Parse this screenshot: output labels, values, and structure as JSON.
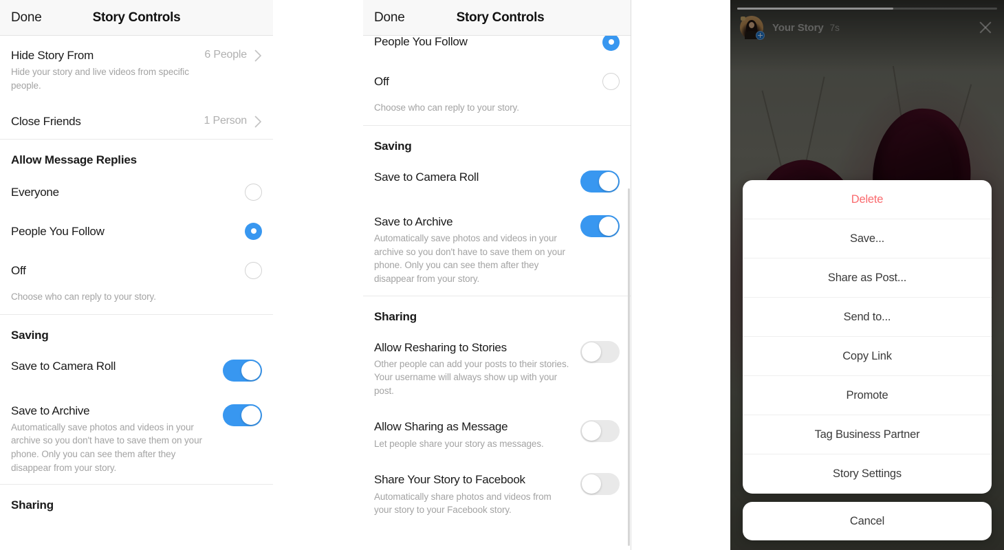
{
  "panels": {
    "left": {
      "nav": {
        "done_label": "Done",
        "title": "Story Controls"
      },
      "rows": [
        {
          "label": "Hide Story From",
          "sub": "Hide your story and live videos from specific people.",
          "value": "6 People",
          "type": "disclosure"
        },
        {
          "label": "Close Friends",
          "sub": "",
          "value": "1 Person",
          "type": "disclosure"
        }
      ],
      "replies": {
        "group_title": "Allow Message Replies",
        "options": [
          {
            "label": "Everyone",
            "selected": false
          },
          {
            "label": "People You Follow",
            "selected": true
          },
          {
            "label": "Off",
            "selected": false
          }
        ],
        "footnote": "Choose who can reply to your story."
      },
      "saving": {
        "group_title": "Saving",
        "items": [
          {
            "label": "Save to Camera Roll",
            "sub": "",
            "on": true
          },
          {
            "label": "Save to Archive",
            "sub": "Automatically save photos and videos in your archive so you don't have to save them on your phone. Only you can see them after they disappear from your story.",
            "on": true
          }
        ]
      },
      "sharing": {
        "group_title": "Sharing"
      }
    },
    "middle": {
      "nav": {
        "done_label": "Done",
        "title": "Story Controls"
      },
      "replies": {
        "options": [
          {
            "label": "People You Follow",
            "selected": true
          },
          {
            "label": "Off",
            "selected": false
          }
        ],
        "footnote": "Choose who can reply to your story."
      },
      "saving": {
        "group_title": "Saving",
        "items": [
          {
            "label": "Save to Camera Roll",
            "sub": "",
            "on": true
          },
          {
            "label": "Save to Archive",
            "sub": "Automatically save photos and videos in your archive so you don't have to save them on your phone. Only you can see them after they disappear from your story.",
            "on": true
          }
        ]
      },
      "sharing": {
        "group_title": "Sharing",
        "items": [
          {
            "label": "Allow Resharing to Stories",
            "sub": "Other people can add your posts to their stories. Your username will always show up with your post.",
            "on": false
          },
          {
            "label": "Allow Sharing as Message",
            "sub": "Let people share your story as messages.",
            "on": false
          },
          {
            "label": "Share Your Story to Facebook",
            "sub": "Automatically share photos and videos from your story to your Facebook story.",
            "on": false
          }
        ]
      }
    },
    "right": {
      "story": {
        "author": "Your Story",
        "timestamp": "7s",
        "progress_percent": 60,
        "close_icon": "close-icon",
        "avatar_badge_icon": "plus-badge-icon"
      },
      "action_sheet": {
        "items": [
          {
            "label": "Delete",
            "style": "danger"
          },
          {
            "label": "Save...",
            "style": "default"
          },
          {
            "label": "Share as Post...",
            "style": "default"
          },
          {
            "label": "Send to...",
            "style": "default"
          },
          {
            "label": "Copy Link",
            "style": "default"
          },
          {
            "label": "Promote",
            "style": "default"
          },
          {
            "label": "Tag Business Partner",
            "style": "default"
          },
          {
            "label": "Story Settings",
            "style": "default"
          }
        ],
        "cancel_label": "Cancel"
      }
    }
  },
  "colors": {
    "accent_blue": "#3897f0",
    "danger_red": "#fa6a6e",
    "header_bg": "#f8f8f8",
    "switch_off": "#e9e9e9"
  }
}
